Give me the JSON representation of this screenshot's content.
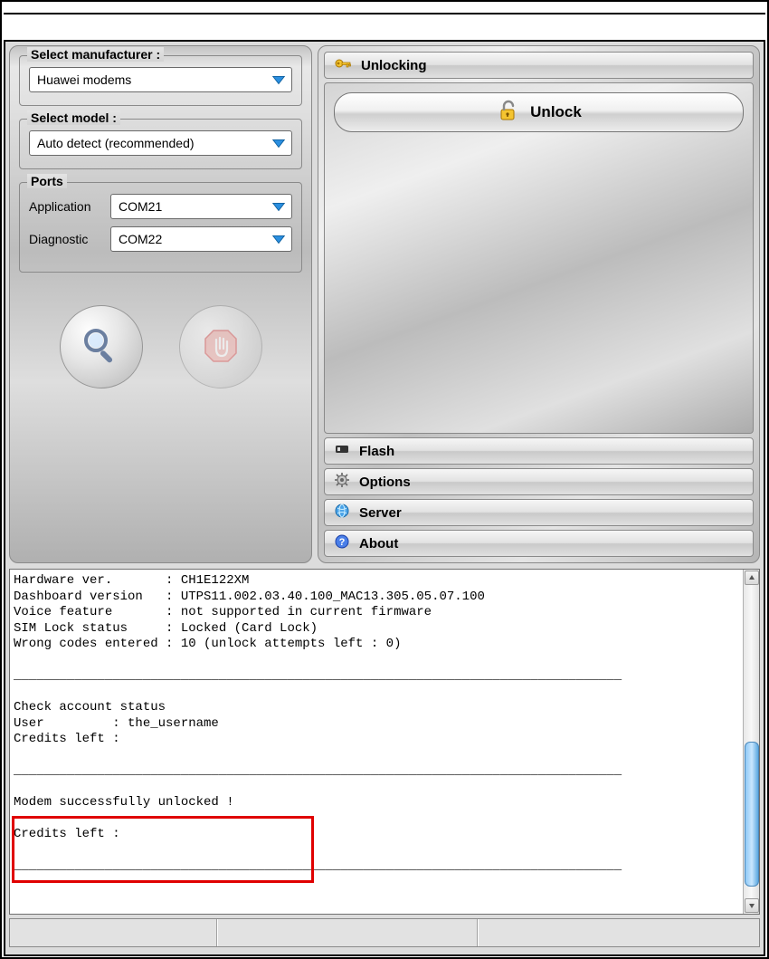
{
  "left": {
    "manufacturer_label": "Select manufacturer :",
    "manufacturer_value": "Huawei modems",
    "model_label": "Select model :",
    "model_value": "Auto detect (recommended)",
    "ports_label": "Ports",
    "application_label": "Application",
    "application_value": "COM21",
    "diagnostic_label": "Diagnostic",
    "diagnostic_value": "COM22"
  },
  "right": {
    "unlocking_header": "Unlocking",
    "unlock_button": "Unlock",
    "flash_header": "Flash",
    "options_header": "Options",
    "server_header": "Server",
    "about_header": "About"
  },
  "log": {
    "text": "Hardware ver.       : CH1E122XM\nDashboard version   : UTPS11.002.03.40.100_MAC13.305.05.07.100\nVoice feature       : not supported in current firmware\nSIM Lock status     : Locked (Card Lock)\nWrong codes entered : 10 (unlock attempts left : 0)\n\n________________________________________________________________________________\n\nCheck account status\nUser         : the_username\nCredits left :\n\n________________________________________________________________________________\n\nModem successfully unlocked !\n\nCredits left :\n\n________________________________________________________________________________"
  }
}
